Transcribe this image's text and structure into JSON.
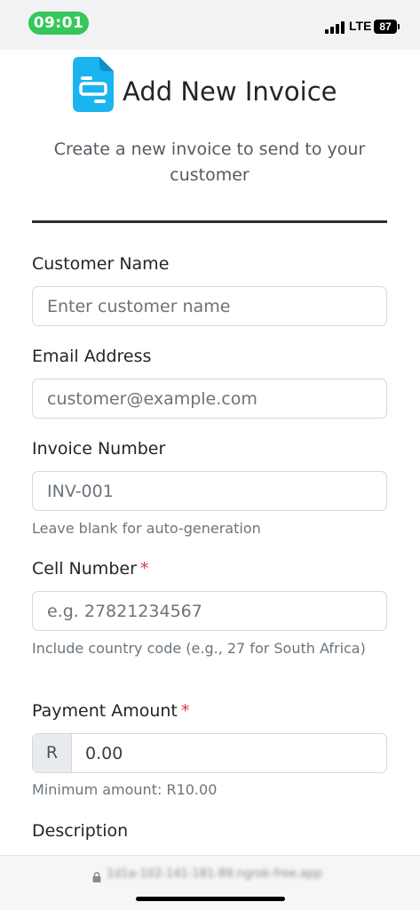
{
  "status_bar": {
    "time": "09:01",
    "network": "LTE",
    "battery": "87",
    "time_pill_color": "#34c759"
  },
  "header": {
    "icon": "invoice-document-icon",
    "icon_color": "#1ab4f0",
    "title": "Add New Invoice",
    "subtitle": "Create a new invoice to send to your customer"
  },
  "form": {
    "customer_name": {
      "label": "Customer Name",
      "placeholder": "Enter customer name"
    },
    "email": {
      "label": "Email Address",
      "placeholder": "customer@example.com"
    },
    "invoice_number": {
      "label": "Invoice Number",
      "placeholder": "INV-001",
      "help": "Leave blank for auto-generation"
    },
    "cell_number": {
      "label": "Cell Number",
      "required_mark": "*",
      "placeholder": "e.g. 27821234567",
      "help": "Include country code (e.g., 27 for South Africa)"
    },
    "payment_amount": {
      "label": "Payment Amount",
      "required_mark": "*",
      "currency": "R",
      "value": "0.00",
      "help": "Minimum amount: R10.00"
    },
    "description": {
      "label": "Description"
    }
  },
  "browser": {
    "url": "1d1a-102-141-181-89.ngrok-free.app",
    "lock_icon": "lock-icon"
  },
  "colors": {
    "required": "#dc3545",
    "text": "#212529",
    "muted": "#6c757d"
  }
}
